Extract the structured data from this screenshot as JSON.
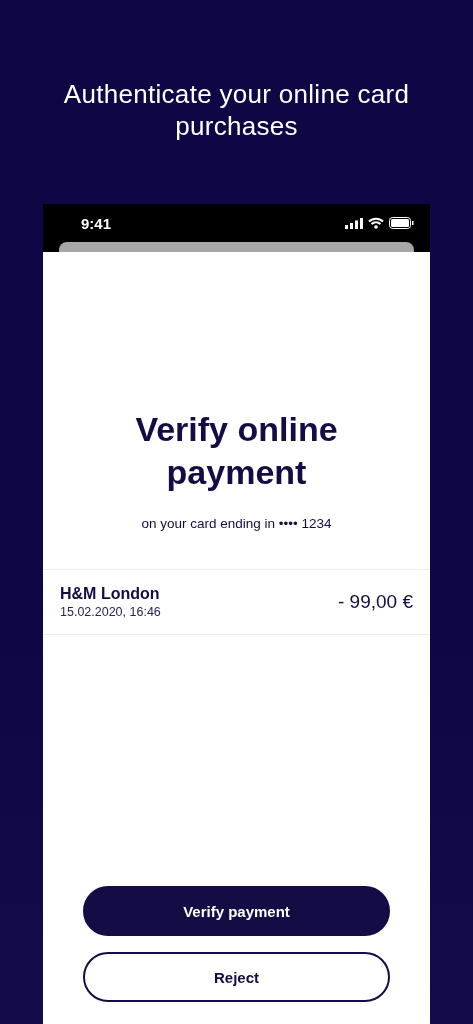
{
  "headline": "Authenticate your online card purchases",
  "status_bar": {
    "time": "9:41"
  },
  "title": "Verify online payment",
  "subtitle": "on your card ending in •••• 1234",
  "transaction": {
    "merchant": "H&M London",
    "datetime": "15.02.2020, 16:46",
    "amount": "- 99,00 €"
  },
  "buttons": [
    {
      "label": "Verify payment",
      "kind": "primary"
    },
    {
      "label": "Reject",
      "kind": "secondary"
    }
  ]
}
